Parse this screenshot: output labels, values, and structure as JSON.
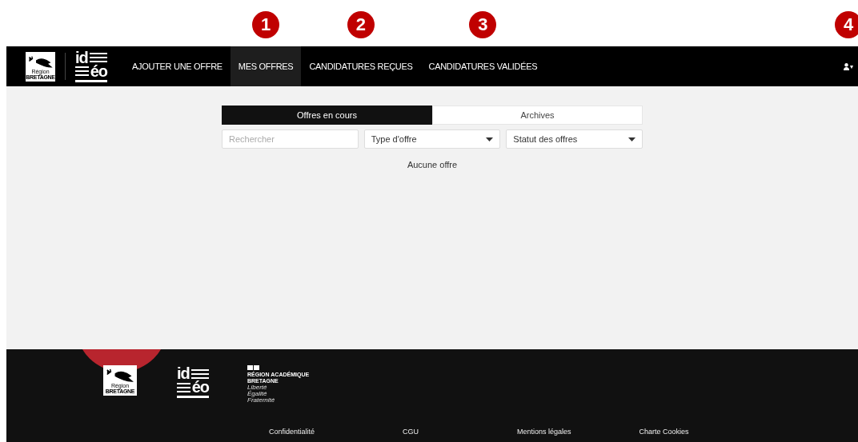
{
  "annotations": [
    "1",
    "2",
    "3",
    "4"
  ],
  "navbar": {
    "region_logo": {
      "line1": "Région",
      "line2": "BRETAGNE"
    },
    "ideo_logo": {
      "top": "id",
      "bottom": "éo"
    },
    "items": [
      {
        "label": "AJOUTER UNE OFFRE",
        "selected": false
      },
      {
        "label": "MES OFFRES",
        "selected": true
      },
      {
        "label": "CANDIDATURES REÇUES",
        "selected": false
      },
      {
        "label": "CANDIDATURES VALIDÉES",
        "selected": false
      }
    ],
    "user_menu": {
      "caret": "▾"
    }
  },
  "tabs": [
    {
      "label": "Offres en cours",
      "selected": true
    },
    {
      "label": "Archives",
      "selected": false
    }
  ],
  "filters": {
    "search": {
      "placeholder": "Rechercher"
    },
    "selects": [
      {
        "value": "Type d'offre"
      },
      {
        "value": "Statut des offres"
      }
    ]
  },
  "empty_message": "Aucune offre",
  "footer": {
    "region_logo": {
      "line1": "Région",
      "line2": "BRETAGNE"
    },
    "ideo_logo": {
      "top": "id",
      "bottom": "éo"
    },
    "academy_logo": {
      "line1": "RÉGION ACADÉMIQUE",
      "line2": "BRETAGNE",
      "motto": [
        "Liberté",
        "Égalité",
        "Fraternité"
      ]
    },
    "links": [
      "Confidentialité",
      "CGU",
      "Mentions légales",
      "Charte Cookies"
    ]
  }
}
